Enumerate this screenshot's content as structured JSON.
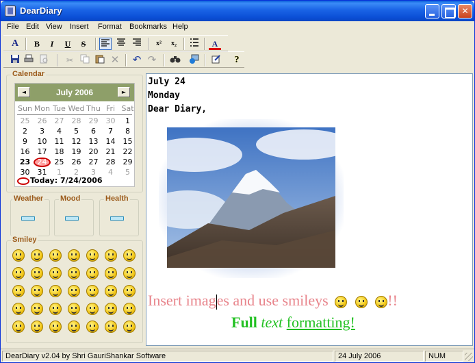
{
  "window": {
    "title": "DearDiary"
  },
  "menu": [
    "File",
    "Edit",
    "View",
    "Insert",
    "Format",
    "Bookmarks",
    "Help"
  ],
  "format_toolbar": {
    "font_icon": "A",
    "bold": "B",
    "italic": "I",
    "underline": "U",
    "strike": "S",
    "superscript": "x²",
    "subscript": "x₂",
    "font_color": "A"
  },
  "calendar": {
    "label": "Calendar",
    "month": "July 2006",
    "prev": "◄",
    "next": "►",
    "dow": [
      "Sun",
      "Mon",
      "Tue",
      "Wed",
      "Thu",
      "Fri",
      "Sat"
    ],
    "weeks": [
      [
        "25",
        "26",
        "27",
        "28",
        "29",
        "30",
        "1"
      ],
      [
        "2",
        "3",
        "4",
        "5",
        "6",
        "7",
        "8"
      ],
      [
        "9",
        "10",
        "11",
        "12",
        "13",
        "14",
        "15"
      ],
      [
        "16",
        "17",
        "18",
        "19",
        "20",
        "21",
        "22"
      ],
      [
        "23",
        "24",
        "25",
        "26",
        "27",
        "28",
        "29"
      ],
      [
        "30",
        "31",
        "1",
        "2",
        "3",
        "4",
        "5"
      ]
    ],
    "today": "Today: 7/24/2006"
  },
  "panels": {
    "weather": "Weather",
    "mood": "Mood",
    "health": "Health",
    "smiley": "Smiley"
  },
  "editor": {
    "line1": "July 24",
    "line2": "Monday",
    "line3": "Dear Diary,",
    "insert_pre": "Insert imag",
    "insert_post": "es and use  smileys",
    "insert_tail": "!!",
    "format_full": "Full",
    "format_text": "text",
    "format_formatting": "formatting!"
  },
  "status": {
    "app": "DearDiary v2.04 by Shri GauriShankar Software",
    "date": "24 July 2006",
    "num": "NUM"
  },
  "colors": {
    "title_blue": "#0a46c4",
    "calendar_header": "#8e9f69",
    "label_brown": "#9b5a1a",
    "pink_text": "#e8848b",
    "green_text": "#21c021"
  },
  "icons": [
    "save-icon",
    "print-icon",
    "print-preview-icon",
    "cut-icon",
    "copy-icon",
    "paste-icon",
    "delete-icon",
    "undo-icon",
    "redo-icon",
    "find-icon",
    "insert-image-icon",
    "edit-icon",
    "help-icon"
  ]
}
